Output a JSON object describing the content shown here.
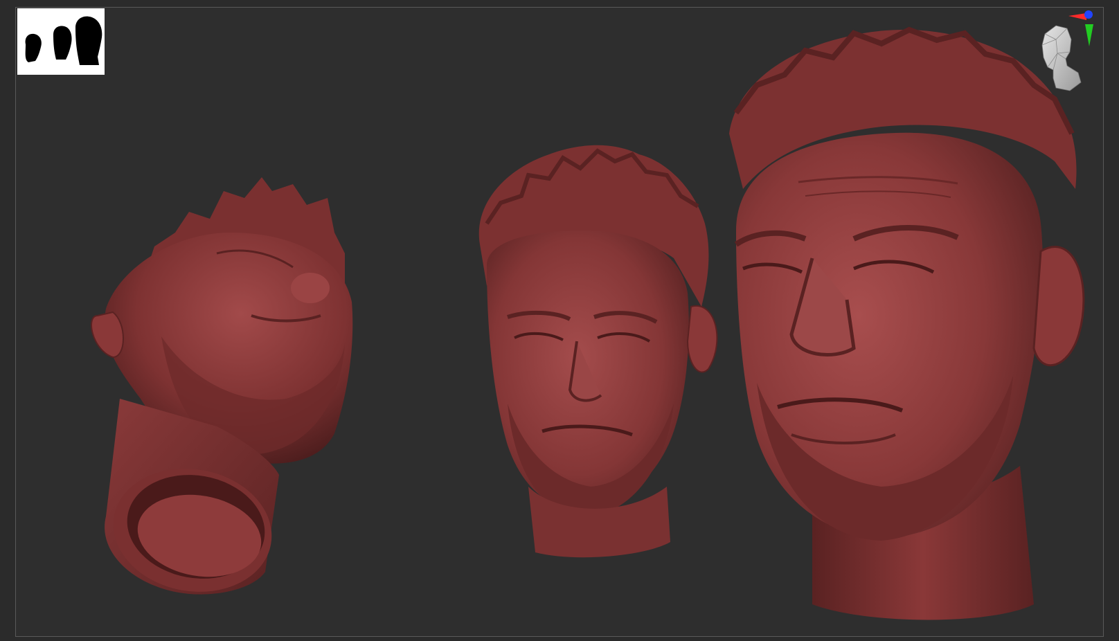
{
  "app": {
    "type": "3d-sculpt-viewport"
  },
  "viewport": {
    "background": "#2e2e2e",
    "material_color": "#8e3b3b"
  },
  "thumbnail": {
    "icon": "silhouette-thumbnail"
  },
  "navigation": {
    "icon": "view-navigation-head-icon",
    "axis_colors": {
      "x": "#ff2a2a",
      "y": "#22cc22",
      "z": "#2244ff"
    }
  },
  "models": [
    {
      "name": "head-bottom-view"
    },
    {
      "name": "head-three-quarter-view"
    },
    {
      "name": "head-closeup-view"
    }
  ]
}
